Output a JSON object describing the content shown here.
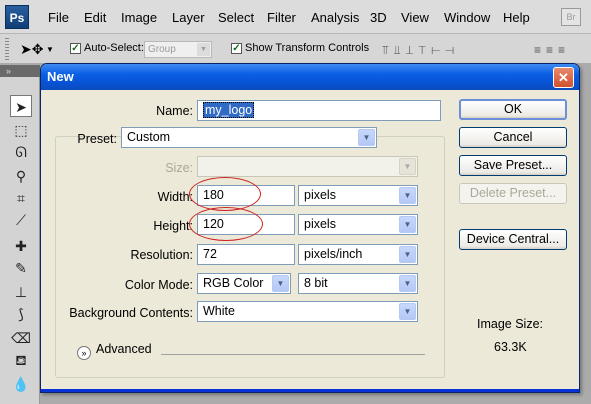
{
  "app": {
    "logo": "Ps",
    "menu": [
      "File",
      "Edit",
      "Image",
      "Layer",
      "Select",
      "Filter",
      "Analysis",
      "3D",
      "View",
      "Window",
      "Help"
    ],
    "bridge_icon": "Br"
  },
  "options_bar": {
    "auto_select_label": "Auto-Select:",
    "auto_select_value": "Group",
    "show_transform_label": "Show Transform Controls"
  },
  "dialog": {
    "title": "New",
    "close": "✕",
    "name_label": "Name:",
    "name_value": "my_logo",
    "preset_label": "Preset:",
    "preset_value": "Custom",
    "size_label": "Size:",
    "size_value": "",
    "width_label": "Width:",
    "width_value": "180",
    "width_unit": "pixels",
    "height_label": "Height:",
    "height_value": "120",
    "height_unit": "pixels",
    "resolution_label": "Resolution:",
    "resolution_value": "72",
    "resolution_unit": "pixels/inch",
    "color_mode_label": "Color Mode:",
    "color_mode_value": "RGB Color",
    "bit_depth_value": "8 bit",
    "background_label": "Background Contents:",
    "background_value": "White",
    "advanced_label": "Advanced",
    "image_size_label": "Image Size:",
    "image_size_value": "63.3K",
    "buttons": {
      "ok": "OK",
      "cancel": "Cancel",
      "save_preset": "Save Preset...",
      "delete_preset": "Delete Preset...",
      "device_central": "Device Central..."
    }
  },
  "colors": {
    "titlebar": "#0a5ee3",
    "dialog_bg": "#ece9d8",
    "annotation": "#cc2222"
  }
}
